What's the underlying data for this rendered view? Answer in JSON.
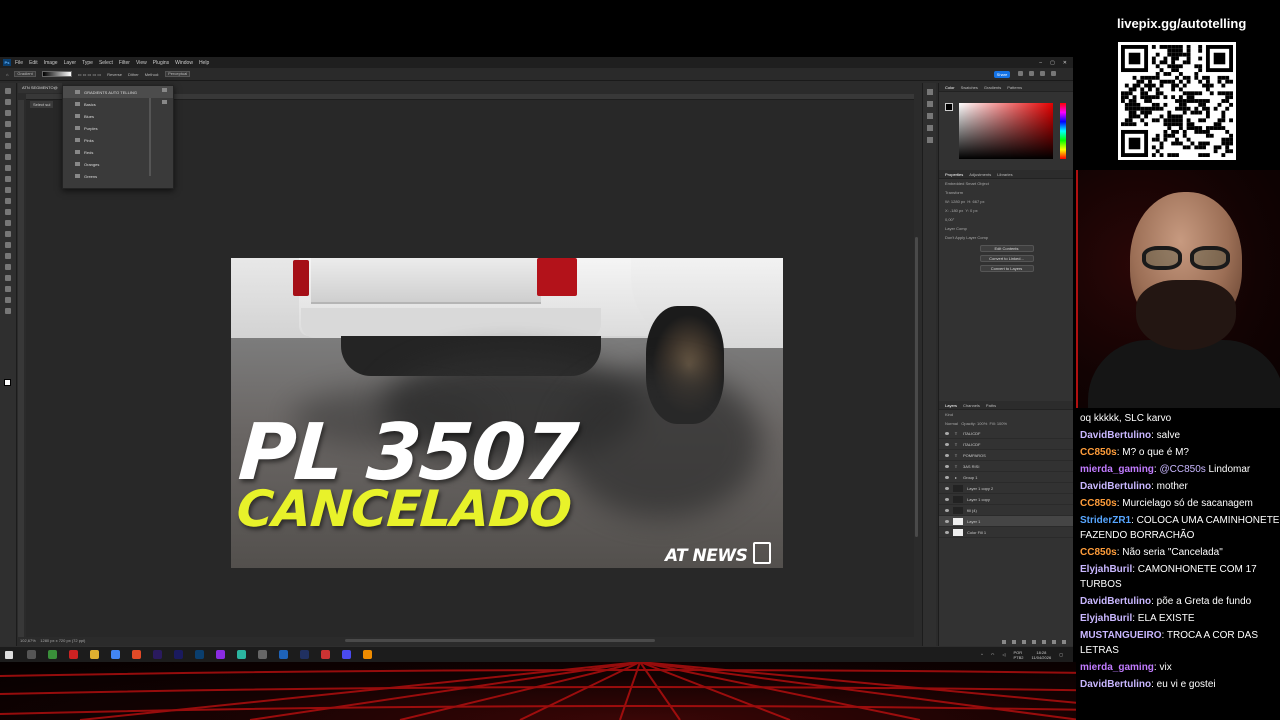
{
  "photoshop": {
    "menu": [
      "File",
      "Edit",
      "Image",
      "Layer",
      "Type",
      "Select",
      "Filter",
      "View",
      "Plugins",
      "Window",
      "Help"
    ],
    "options": {
      "preset": "Gradient",
      "reverse": "Reverse",
      "dither": "Dither",
      "method_label": "Method:",
      "method_value": "Perceptual"
    },
    "share_label": "Share",
    "doc_tab": "ATN SEGMENTO@",
    "select_subject": "Select sul",
    "gradient_presets": {
      "header": "GRADIENTS AUTO TELLING",
      "folders": [
        "Basics",
        "Blues",
        "Purples",
        "Pinks",
        "Reds",
        "Oranges",
        "Greens"
      ]
    },
    "status": {
      "zoom": "102,67%",
      "size": "1280 px x 720 px (72 ppi)"
    },
    "artwork": {
      "headline": "PL 3507",
      "subheadline": "CANCELADO",
      "brand": "AT NEWS"
    },
    "color_panel": {
      "tabs": [
        "Color",
        "Swatches",
        "Gradients",
        "Patterns"
      ],
      "accent": "#e40000"
    },
    "properties": {
      "tabs": [
        "Properties",
        "Adjustments",
        "Libraries"
      ],
      "object": "Embedded Smart Object",
      "transform": "Transform",
      "w": "W: 1280 px",
      "h": "H: 667 px",
      "x": "X: -180 px",
      "y": "Y: 0 px",
      "angle": "0,00°",
      "layer_comp": "Layer Comp",
      "layer_comp_value": "Don't Apply Layer Comp",
      "buttons": [
        "Edit Contents",
        "Convert to Linked...",
        "Convert to Layers"
      ]
    },
    "layers": {
      "tabs": [
        "Layers",
        "Channels",
        "Paths"
      ],
      "filter": "Kind",
      "blend": "Normal",
      "opacity": "Opacity: 100%",
      "fill": "Fill: 100%",
      "items": [
        "ITALICDF",
        "ITALICDF",
        "POMPAROS",
        "3AS RISI",
        "Group 1",
        "Layer 1 copy 2",
        "Layer 1 copy",
        "fill (4)",
        "Layer 1",
        "Color Fill 1"
      ]
    }
  },
  "taskbar": {
    "lang": "POR\nPTB2",
    "time": "18:28",
    "date": "11/04/2026"
  },
  "overlay": {
    "qr_url": "livepix.gg/autotelling"
  },
  "chat": [
    {
      "user": "",
      "text": "oq kkkkk, SLC karvo",
      "color": "#ffffff"
    },
    {
      "user": "DavidBertulino",
      "text": ": salve",
      "color": "#c9b7ff"
    },
    {
      "user": "CC850s",
      "text": ": M? o que é M?",
      "color": "#ff9d3b"
    },
    {
      "user": "mierda_gaming",
      "text": ": ",
      "mention": "@CC850s",
      "text2": " Lindomar",
      "color": "#c17bff",
      "mention_color": "#c9b7ff"
    },
    {
      "user": "DavidBertulino",
      "text": ": mother",
      "color": "#c9b7ff"
    },
    {
      "user": "CC850s",
      "text": ": Murcielago só de sacanagem",
      "color": "#ff9d3b"
    },
    {
      "user": "StriderZR1",
      "text": ": COLOCA UMA CAMINHONETE FAZENDO BORRACHÃO",
      "color": "#57a6ff"
    },
    {
      "user": "CC850s",
      "text": ": Não seria \"Cancelada\"",
      "color": "#ff9d3b"
    },
    {
      "user": "ElyjahBuril",
      "text": ": CAMONHONETE COM 17 TURBOS",
      "color": "#c9b7ff"
    },
    {
      "user": "DavidBertulino",
      "text": ": põe a Greta de fundo",
      "color": "#c9b7ff"
    },
    {
      "user": "ElyjahBuril",
      "text": ": ELA EXISTE",
      "color": "#c9b7ff"
    },
    {
      "user": "MUSTANGUEIRO",
      "text": ": TROCA A COR DAS LETRAS",
      "color": "#c9b7ff"
    },
    {
      "user": "mierda_gaming",
      "text": ": vix",
      "color": "#c17bff"
    },
    {
      "user": "DavidBertulino",
      "text": ": eu vi e gostei",
      "color": "#c9b7ff"
    }
  ]
}
